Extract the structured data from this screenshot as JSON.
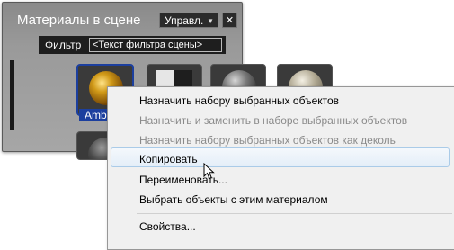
{
  "panel": {
    "title": "Материалы в сцене",
    "manage_label": "Управл.",
    "close_glyph": "✕",
    "filter_label": "Фильтр",
    "filter_value": "<Текст фильтра сцены>",
    "selected_material_label": "Amb"
  },
  "context_menu": {
    "items": [
      {
        "label": "Назначить набору выбранных объектов",
        "enabled": true
      },
      {
        "label": "Назначить и заменить в наборе выбранных объектов",
        "enabled": false
      },
      {
        "label": "Назначить набору выбранных объектов как деколь",
        "enabled": false
      },
      {
        "label": "Копировать",
        "enabled": true,
        "hovered": true
      },
      {
        "label": "Переименовать...",
        "enabled": true
      },
      {
        "label": "Выбрать объекты с этим материалом",
        "enabled": true
      },
      {
        "label": "Свойства...",
        "enabled": true
      }
    ]
  },
  "colors": {
    "selection": "#1c3f9e",
    "menu_hover_border": "#aacbe8"
  }
}
